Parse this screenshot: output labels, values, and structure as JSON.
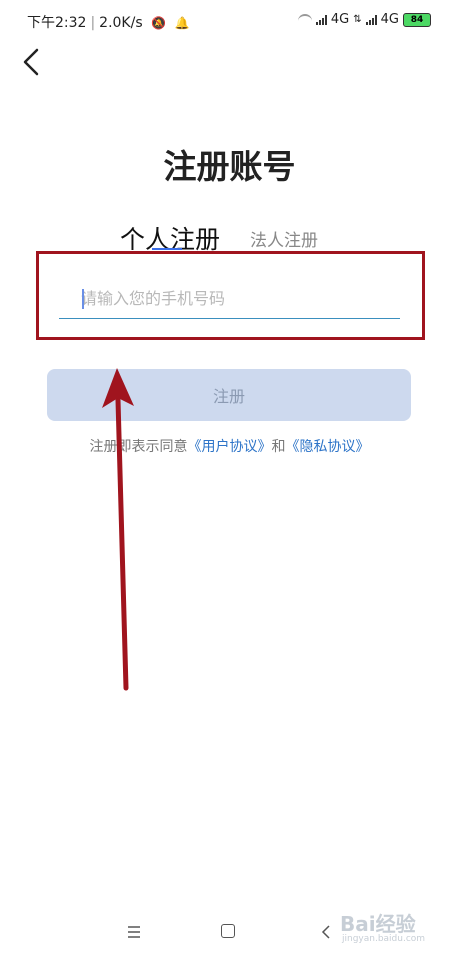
{
  "status_bar": {
    "time": "下午2:32",
    "speed": "2.0K/s",
    "network_1": "4G",
    "network_2": "4G",
    "battery": "84"
  },
  "header": {
    "back_icon": "chevron-left-icon"
  },
  "page": {
    "title": "注册账号"
  },
  "tabs": [
    {
      "label": "个人注册",
      "active": true
    },
    {
      "label": "法人注册",
      "active": false
    }
  ],
  "form": {
    "phone_placeholder": "请输入您的手机号码",
    "phone_value": "",
    "submit_label": "注册"
  },
  "agreement": {
    "prefix": "注册即表示同意",
    "user_agreement": "《用户协议》",
    "and": "和",
    "privacy_policy": "《隐私协议》"
  },
  "nav_bar": {
    "icons": [
      "menu-icon",
      "home-icon",
      "back-icon"
    ]
  },
  "watermark": {
    "brand": "Bai经验",
    "site": "jingyan.baidu.com"
  },
  "colors": {
    "highlight_box": "#a0141e",
    "arrow": "#a0141e",
    "link": "#2d74c8",
    "button_bg": "#cdd9ee",
    "input_underline": "#3a8fbe"
  }
}
